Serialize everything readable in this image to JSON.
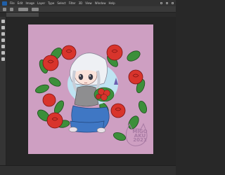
{
  "menu": {
    "items": [
      "Ps",
      "File",
      "Edit",
      "Image",
      "Layer",
      "Type",
      "Select",
      "Filter",
      "3D",
      "View",
      "Window",
      "Help"
    ]
  },
  "document": {
    "tab_title": "",
    "artwork": "chibi girl with red rose bouquet, pink background, red roses with green leaves",
    "signature": "MIGO\nAKU\n2021"
  },
  "status": {
    "zoom": "",
    "doc_info": ""
  },
  "colors": {
    "canvas_background": "#ce9fc2",
    "rose": "#d8342c",
    "leaf": "#3c8f3a",
    "ui_dark": "#282828"
  },
  "icons": [
    "app-logo-icon",
    "move-tool-icon",
    "marquee-tool-icon",
    "lasso-tool-icon",
    "brush-tool-icon",
    "eraser-tool-icon",
    "text-tool-icon",
    "zoom-tool-icon"
  ]
}
